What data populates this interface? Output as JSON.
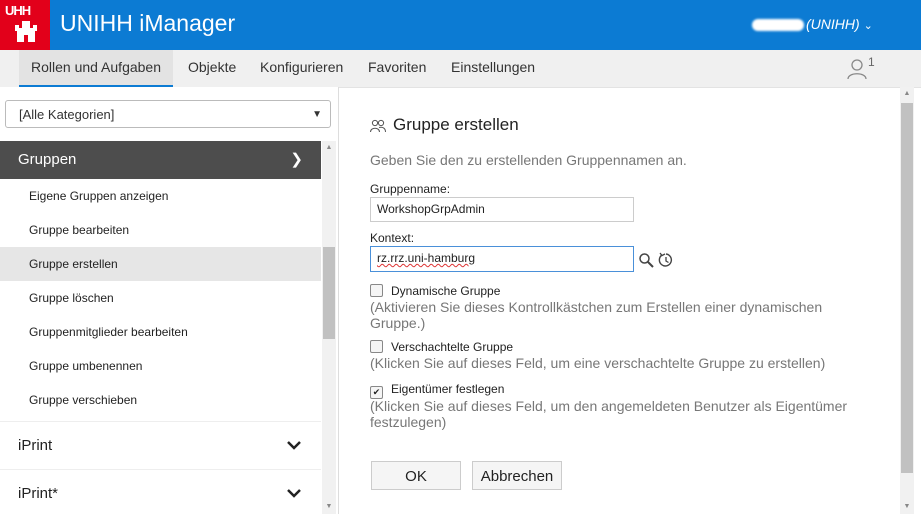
{
  "header": {
    "logo_text": "UHH",
    "app_title": "UNIHH iManager",
    "user_suffix": "(UNIHH)"
  },
  "nav": {
    "tabs": [
      "Rollen und Aufgaben",
      "Objekte",
      "Konfigurieren",
      "Favoriten",
      "Einstellungen"
    ],
    "notification_count": "1"
  },
  "sidebar": {
    "category_select": "[Alle Kategorien]",
    "group_title": "Gruppen",
    "items": [
      "Eigene Gruppen anzeigen",
      "Gruppe bearbeiten",
      "Gruppe erstellen",
      "Gruppe löschen",
      "Gruppenmitglieder bearbeiten",
      "Gruppe umbenennen",
      "Gruppe verschieben"
    ],
    "sections": [
      "iPrint",
      "iPrint*"
    ]
  },
  "form": {
    "title": "Gruppe erstellen",
    "description": "Geben Sie den zu erstellenden Gruppennamen an.",
    "name_label": "Gruppenname:",
    "name_value": "WorkshopGrpAdmin",
    "context_label": "Kontext:",
    "context_value": "rz.rrz.uni-hamburg",
    "dynamic_label": "Dynamische Gruppe",
    "dynamic_help": "(Aktivieren Sie dieses Kontrollkästchen zum Erstellen einer dynamischen Gruppe.)",
    "nested_label": "Verschachtelte Gruppe",
    "nested_help": "(Klicken Sie auf dieses Feld, um eine verschachtelte Gruppe zu erstellen)",
    "owner_label": "Eigentümer festlegen",
    "owner_help": "(Klicken Sie auf dieses Feld, um den angemeldeten Benutzer als Eigentümer festzulegen)",
    "ok_label": "OK",
    "cancel_label": "Abbrechen"
  },
  "colors": {
    "header_bg": "#0c7bd3",
    "logo_bg": "#e2001a",
    "group_header_bg": "#4d4d4d"
  }
}
